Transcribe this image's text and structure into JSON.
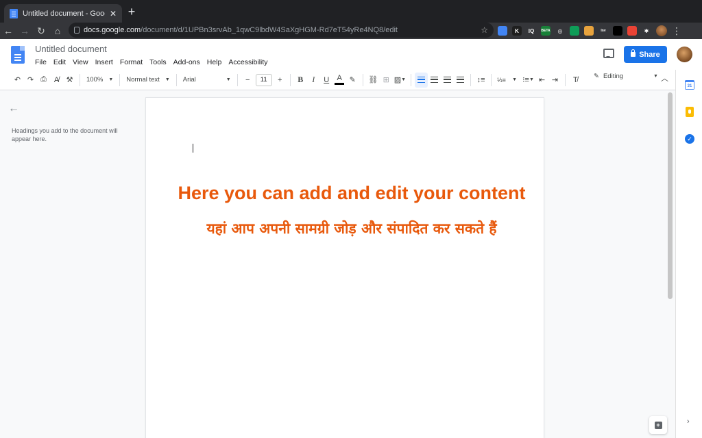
{
  "browser": {
    "tab_title": "Untitled document - Google Do",
    "tab_close": "✕",
    "new_tab": "+",
    "url_host": "docs.google.com",
    "url_path": "/document/d/1UPBn3srvAb_1qwC9lbdW4SaXgHGM-Rd7eT54yRe4NQ8/edit",
    "extensions": [
      {
        "name": "extension-1",
        "label": "",
        "color": "#4285f4"
      },
      {
        "name": "extension-k",
        "label": "K",
        "color": "#1f1f1f"
      },
      {
        "name": "extension-iq",
        "label": "IQ",
        "color": "#35363a"
      },
      {
        "name": "extension-beta",
        "label": "BETA",
        "color": "#188038"
      },
      {
        "name": "extension-circle",
        "label": "◎",
        "color": "#35363a"
      },
      {
        "name": "extension-save",
        "label": "",
        "color": "#0f9d58"
      },
      {
        "name": "extension-cookie",
        "label": "",
        "color": "#e8a33d"
      },
      {
        "name": "extension-inv",
        "label": "Inv",
        "color": "#35363a"
      },
      {
        "name": "extension-camera",
        "label": "",
        "color": "#000000"
      },
      {
        "name": "extension-red",
        "label": "",
        "color": "#ea4335"
      },
      {
        "name": "extension-puzzle",
        "label": "✱",
        "color": "#35363a"
      }
    ]
  },
  "docs": {
    "title": "Untitled document",
    "menu": [
      "File",
      "Edit",
      "View",
      "Insert",
      "Format",
      "Tools",
      "Add-ons",
      "Help",
      "Accessibility"
    ],
    "share_label": "Share"
  },
  "toolbar": {
    "zoom": "100%",
    "style": "Normal text",
    "font": "Arial",
    "font_size": "11",
    "bold": "B",
    "italic": "I",
    "underline": "U",
    "text_color": "A",
    "mode": "Editing"
  },
  "outline": {
    "hint": "Headings you add to the document will appear here."
  },
  "document": {
    "heading_en": "Here you can add and edit your content",
    "heading_hi": "यहां आप अपनी सामग्री जोड़ और संपादित कर सकते हैं",
    "heading_color": "#e8590c"
  },
  "side_panel": {
    "calendar_day": "31"
  },
  "colors": {
    "accent": "#1a73e8",
    "chrome_dark": "#202124"
  }
}
